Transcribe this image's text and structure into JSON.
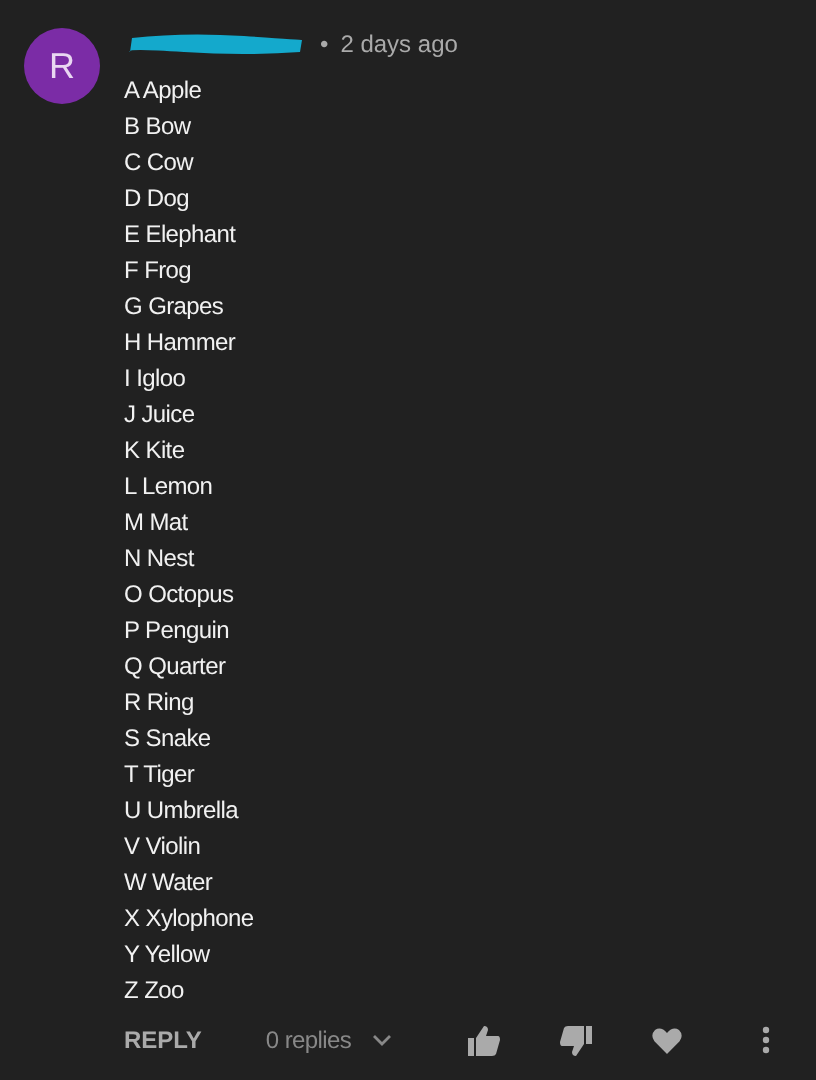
{
  "comment": {
    "avatar_letter": "R",
    "author_redacted": true,
    "separator": "•",
    "time": "2 days ago",
    "lines": [
      "A Apple",
      "B Bow",
      "C Cow",
      "D Dog",
      "E Elephant",
      "F Frog",
      "G Grapes",
      "H Hammer",
      "I Igloo",
      "J Juice",
      "K Kite",
      "L Lemon",
      "M Mat",
      "N Nest",
      "O Octopus",
      "P Penguin",
      "Q Quarter",
      "R Ring",
      "S Snake",
      "T Tiger",
      "U Umbrella",
      "V Violin",
      "W Water",
      "X Xylophone",
      "Y Yellow",
      "Z Zoo"
    ]
  },
  "actions": {
    "reply": "REPLY",
    "replies": "0 replies"
  }
}
